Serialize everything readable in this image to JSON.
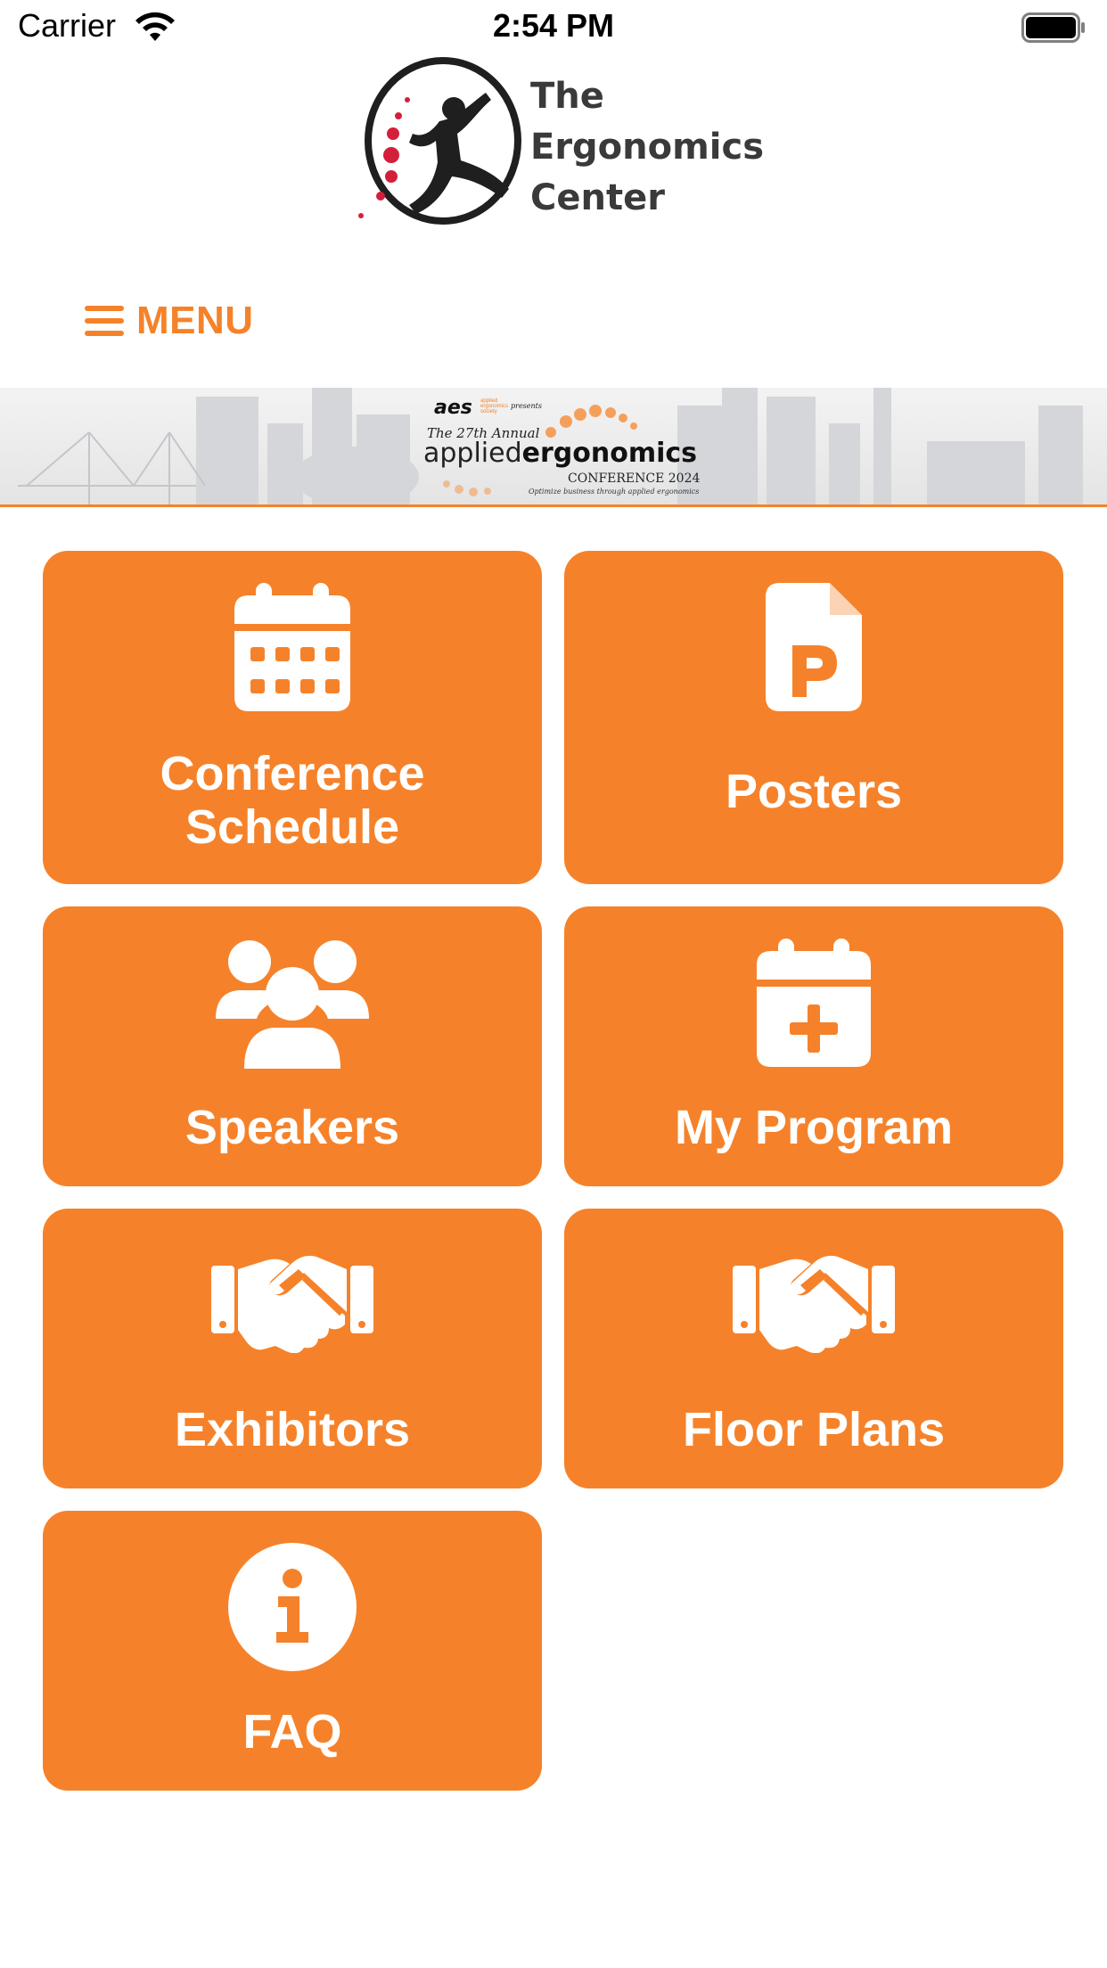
{
  "status_bar": {
    "carrier": "Carrier",
    "time": "2:54 PM"
  },
  "logo": {
    "line1": "The",
    "line2": "Ergonomics",
    "line3": "Center"
  },
  "menu": {
    "label": "MENU"
  },
  "banner": {
    "aes": "aes",
    "aes_sub": "applied ergonomics society",
    "presents": "presents",
    "annual": "The 27th Annual",
    "title_pre": "applied",
    "title_e": "e",
    "title_post": "rgonomics",
    "conference": "CONFERENCE 2024",
    "tagline": "Optimize business through applied ergonomics"
  },
  "tiles": [
    {
      "label": "Conference Schedule",
      "icon": "calendar-icon"
    },
    {
      "label": "Posters",
      "icon": "poster-file-icon"
    },
    {
      "label": "Speakers",
      "icon": "users-icon"
    },
    {
      "label": "My Program",
      "icon": "calendar-plus-icon"
    },
    {
      "label": "Exhibitors",
      "icon": "handshake-icon"
    },
    {
      "label": "Floor Plans",
      "icon": "handshake-icon"
    },
    {
      "label": "FAQ",
      "icon": "info-icon"
    }
  ],
  "colors": {
    "accent": "#f5822a",
    "tile_text": "#ffffff",
    "logo_red": "#d41f3a"
  }
}
